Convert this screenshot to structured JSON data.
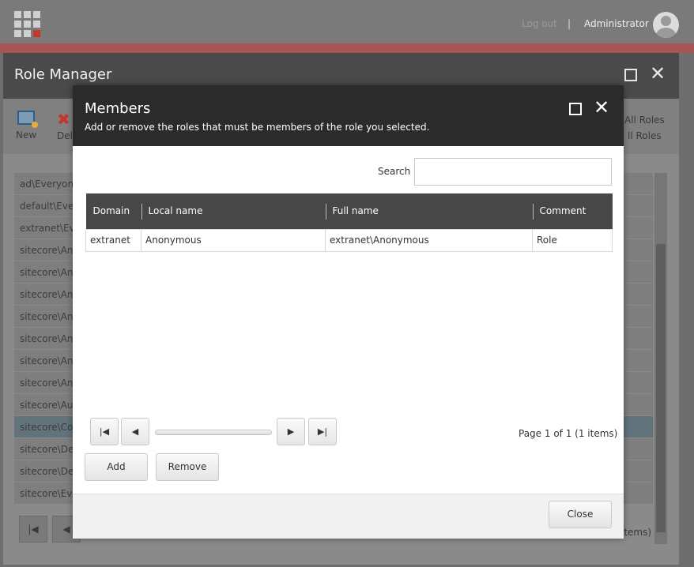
{
  "topbar": {
    "logout_label": "Log out",
    "separator": "|",
    "user_name": "Administrator"
  },
  "role_manager": {
    "title": "Role Manager",
    "toolbar": {
      "new_label": "New",
      "delete_label": "Del",
      "all_roles_1": "All Roles",
      "all_roles_2": "ll Roles"
    },
    "rows": [
      "ad\\Everyone",
      "default\\Everyone",
      "extranet\\Eve",
      "sitecore\\Ana",
      "sitecore\\Ana",
      "sitecore\\Ana",
      "sitecore\\Ana",
      "sitecore\\Ana",
      "sitecore\\Ana",
      "sitecore\\Ana",
      "sitecore\\Aut",
      "sitecore\\Cov",
      "sitecore\\Des",
      "sitecore\\Dev",
      "sitecore\\Eve"
    ],
    "selected_row_index": 11,
    "pager_info": "items)"
  },
  "members_dialog": {
    "title": "Members",
    "subtitle": "Add or remove the roles that must be members of the role you selected.",
    "search_label": "Search",
    "search_value": "",
    "columns": [
      "Domain",
      "Local name",
      "Full name",
      "Comment"
    ],
    "rows": [
      {
        "domain": "extranet",
        "local_name": "Anonymous",
        "full_name": "extranet\\Anonymous",
        "comment": "Role"
      }
    ],
    "page_info": "Page 1 of 1 (1 items)",
    "add_label": "Add",
    "remove_label": "Remove",
    "close_label": "Close"
  }
}
